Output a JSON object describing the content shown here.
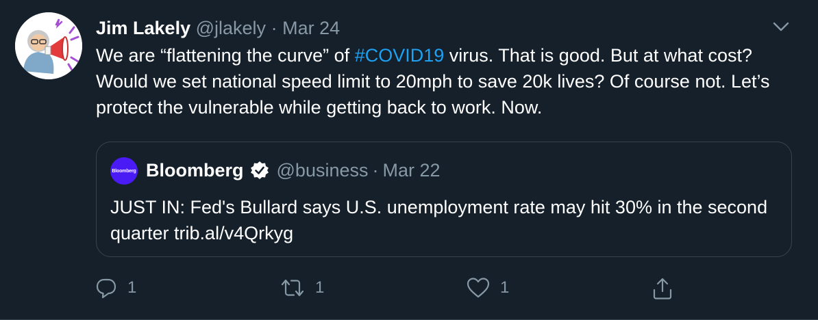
{
  "author": {
    "name": "Jim Lakely",
    "handle": "@jlakely",
    "separator": "·",
    "date": "Mar 24"
  },
  "tweet": {
    "text_part1": "We are “flattening the curve” of ",
    "hashtag": "#COVID19",
    "text_part2": " virus. That is good. But at what cost? Would we set national speed limit to 20mph to save 20k lives? Of course not. Let’s protect the vulnerable while getting back to work. Now."
  },
  "quoted": {
    "avatar_text": "Bloomberg",
    "name": "Bloomberg",
    "handle": "@business",
    "separator": "·",
    "date": "Mar 22",
    "text": "JUST IN: Fed's Bullard says U.S. unemployment rate may hit 30% in the second quarter trib.al/v4Qrkyg"
  },
  "actions": {
    "reply_count": "1",
    "retweet_count": "1",
    "like_count": "1"
  },
  "icons": {
    "menu": "chevron-down-icon",
    "verified": "verified-badge-icon",
    "reply": "reply-icon",
    "retweet": "retweet-icon",
    "like": "heart-icon",
    "share": "share-icon"
  },
  "colors": {
    "background": "#15202b",
    "accent": "#1da1f2",
    "muted": "#8899a6",
    "border": "#38444d",
    "bloomberg": "#4a1bf5"
  }
}
